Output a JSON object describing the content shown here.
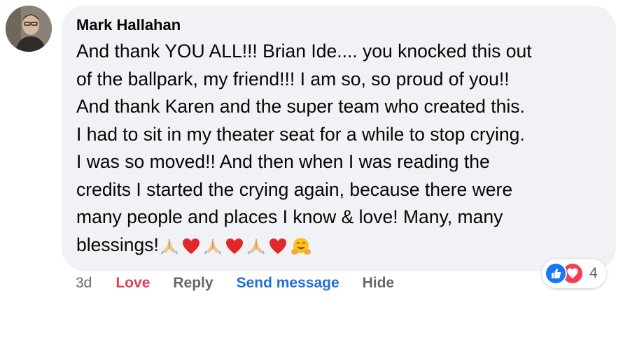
{
  "comment": {
    "author": "Mark Hallahan",
    "lines": [
      "And thank YOU ALL!!! Brian Ide.... you knocked this out",
      "of the ballpark, my friend!!! I am so, so proud of you!!",
      "And thank Karen and the super team who created this.",
      "I had to sit in my theater seat for a while to stop crying.",
      "I was so moved!! And then when I was reading the",
      "credits I started the crying again, because there were",
      "many people and places I know & love! Many, many",
      "blessings!"
    ],
    "emojis": [
      "folded-hands",
      "red-heart",
      "folded-hands",
      "red-heart",
      "folded-hands",
      "red-heart",
      "smiling-face-with-open-hands"
    ]
  },
  "reactions": {
    "icons": [
      "like-icon",
      "love-icon"
    ],
    "count": "4",
    "like_color": "#1877f2",
    "love_color": "#f33e58"
  },
  "actions": {
    "time": "3d",
    "love": "Love",
    "reply": "Reply",
    "send_message": "Send message",
    "hide": "Hide",
    "love_color": "#e33e5a",
    "link_color": "#216fdb"
  }
}
